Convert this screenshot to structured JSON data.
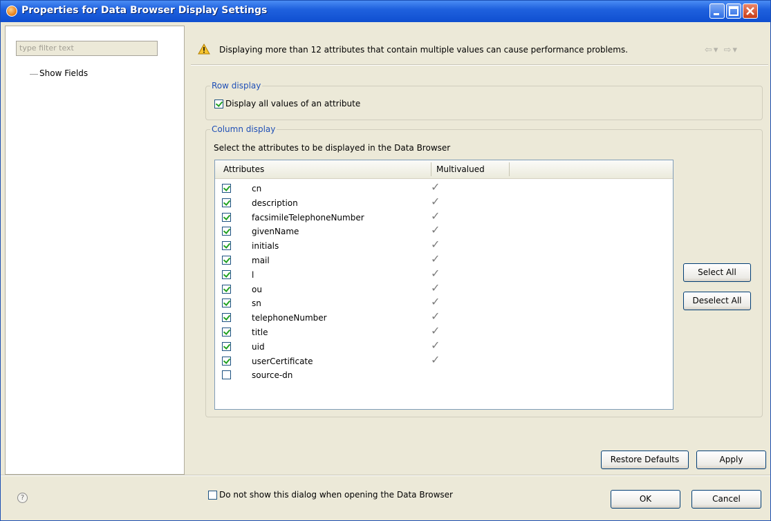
{
  "window": {
    "title": "Properties for Data Browser Display Settings"
  },
  "left_pane": {
    "filter_placeholder": "type filter text",
    "tree_items": [
      {
        "label": "Show Fields"
      }
    ]
  },
  "message": {
    "text": "Displaying more than 12 attributes that contain multiple values can cause performance problems.",
    "icon": "warning-icon",
    "nav_back": "back-arrow-icon",
    "nav_forward": "forward-arrow-icon"
  },
  "row_display": {
    "title": "Row display",
    "checkbox_label": "Display all values of an attribute",
    "checked": true
  },
  "column_display": {
    "title": "Column display",
    "instruction": "Select the attributes to be displayed in the Data Browser",
    "columns": [
      "Attributes",
      "Multivalued"
    ],
    "rows": [
      {
        "name": "cn",
        "checked": true,
        "multivalued": true
      },
      {
        "name": "description",
        "checked": true,
        "multivalued": true
      },
      {
        "name": "facsimileTelephoneNumber",
        "checked": true,
        "multivalued": true
      },
      {
        "name": "givenName",
        "checked": true,
        "multivalued": true
      },
      {
        "name": "initials",
        "checked": true,
        "multivalued": true
      },
      {
        "name": "mail",
        "checked": true,
        "multivalued": true
      },
      {
        "name": "l",
        "checked": true,
        "multivalued": true
      },
      {
        "name": "ou",
        "checked": true,
        "multivalued": true
      },
      {
        "name": "sn",
        "checked": true,
        "multivalued": true
      },
      {
        "name": "telephoneNumber",
        "checked": true,
        "multivalued": true
      },
      {
        "name": "title",
        "checked": true,
        "multivalued": true
      },
      {
        "name": "uid",
        "checked": true,
        "multivalued": true
      },
      {
        "name": "userCertificate",
        "checked": true,
        "multivalued": true
      },
      {
        "name": "source-dn",
        "checked": false,
        "multivalued": false
      }
    ],
    "select_all": "Select All",
    "deselect_all": "Deselect All"
  },
  "dont_show": {
    "label": "Do not show this dialog when opening the Data Browser",
    "checked": false
  },
  "buttons": {
    "restore_defaults": "Restore Defaults",
    "apply": "Apply",
    "ok": "OK",
    "cancel": "Cancel"
  },
  "colors": {
    "title_bar": "#0f4fd0",
    "group_title": "#1f4fb6",
    "check": "#21a121",
    "dialog_bg": "#ece9d8"
  }
}
